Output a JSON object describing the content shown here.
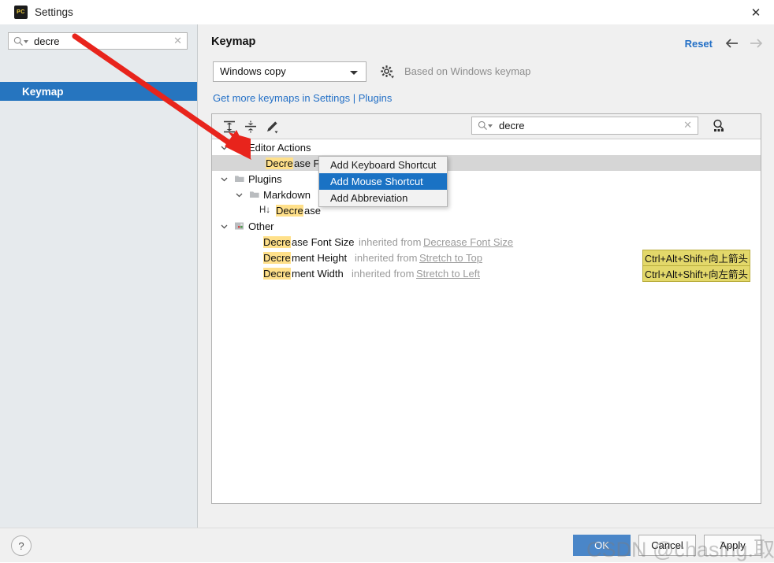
{
  "window": {
    "title": "Settings",
    "app_icon": "pycharm-icon",
    "app_icon_text": "PC",
    "close_icon": "close-icon"
  },
  "sidebar": {
    "search": {
      "value": "decre",
      "placeholder": "",
      "icon": "search-icon",
      "clear_icon": "clear-icon"
    },
    "items": [
      {
        "label": "Keymap",
        "selected": true
      }
    ]
  },
  "header": {
    "title": "Keymap",
    "reset_label": "Reset",
    "back_icon": "arrow-left-icon",
    "forward_icon": "arrow-right-icon"
  },
  "keymap": {
    "selected": "Windows copy",
    "options": [
      "Windows copy"
    ],
    "gear_icon": "gear-icon",
    "based_on": "Based on Windows keymap",
    "plugins_link": "Get more keymaps in Settings | Plugins"
  },
  "toolbar": {
    "expand_all_icon": "expand-all-icon",
    "collapse_all_icon": "collapse-all-icon",
    "edit_icon": "pencil-icon",
    "filter_icon": "find-shortcut-icon",
    "search": {
      "value": "decre",
      "icon": "search-icon",
      "clear_icon": "clear-icon"
    }
  },
  "tree": {
    "rows": [
      {
        "id": "editor-actions",
        "label": "Editor Actions",
        "indent": 16,
        "twisty": "expanded",
        "icon": "plugin-node-icon",
        "selected": false
      },
      {
        "id": "decrease-font-size-editor",
        "label": "Decrease Fo",
        "highlight": "Decre",
        "indent": 60,
        "twisty": "none",
        "icon": "none",
        "selected": true
      },
      {
        "id": "plugins",
        "label": "Plugins",
        "indent": 16,
        "twisty": "expanded",
        "icon": "folder-icon",
        "selected": false
      },
      {
        "id": "markdown",
        "label": "Markdown",
        "indent": 38,
        "twisty": "expanded",
        "icon": "folder-icon",
        "selected": false
      },
      {
        "id": "markdown-decrease",
        "label": "Decrease",
        "highlight": "Decre",
        "indent": 60,
        "twisty": "none",
        "icon": "heading-down-icon",
        "selected": false
      },
      {
        "id": "other",
        "label": "Other",
        "indent": 16,
        "twisty": "expanded",
        "icon": "plugin-node-icon",
        "selected": false
      },
      {
        "id": "decrease-font-size-other",
        "label": "Decrease Font Size",
        "highlight": "Decre",
        "inherited_text": "inherited from",
        "inherited_link": "Decrease Font Size",
        "indent": 60,
        "twisty": "none",
        "icon": "none",
        "selected": false
      },
      {
        "id": "decrement-height",
        "label": "Decrement Height",
        "highlight": "Decre",
        "inherited_text": "inherited from",
        "inherited_link": "Stretch to Top",
        "shortcut": "Ctrl+Alt+Shift+向上箭头",
        "indent": 60,
        "twisty": "none",
        "icon": "none",
        "selected": false
      },
      {
        "id": "decrement-width",
        "label": "Decrement Width",
        "highlight": "Decre",
        "inherited_text": "inherited from",
        "inherited_link": "Stretch to Left",
        "shortcut": "Ctrl+Alt+Shift+向左箭头",
        "indent": 60,
        "twisty": "none",
        "icon": "none",
        "selected": false
      }
    ]
  },
  "context_menu": {
    "items": [
      {
        "label": "Add Keyboard Shortcut",
        "highlighted": false
      },
      {
        "label": "Add Mouse Shortcut",
        "highlighted": true
      },
      {
        "label": "Add Abbreviation",
        "highlighted": false
      }
    ]
  },
  "footer": {
    "help_label": "?",
    "ok_label": "OK",
    "cancel_label": "Cancel",
    "apply_label": "Apply"
  },
  "overlay": {
    "watermark": "CSDN @chasing.取少",
    "arrow_color": "#e8241c"
  },
  "colors": {
    "accent": "#2675bf",
    "link": "#2470c6",
    "selection": "#1a72c4",
    "highlight": "#ffe08a",
    "shortcut_badge": "#e3d86a"
  }
}
